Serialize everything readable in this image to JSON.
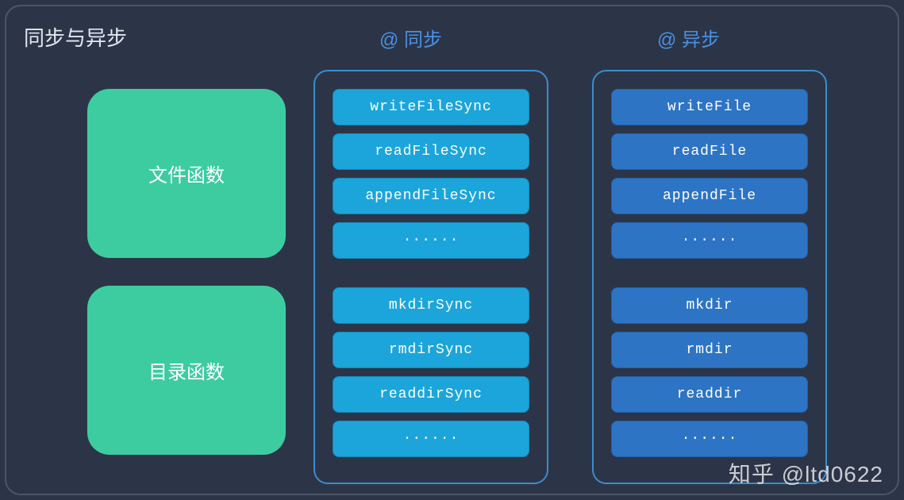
{
  "title": "同步与异步",
  "columns": {
    "sync": {
      "header": "@ 同步"
    },
    "async": {
      "header": "@ 异步"
    }
  },
  "categories": {
    "file": {
      "label": "文件函数"
    },
    "dir": {
      "label": "目录函数"
    }
  },
  "sync_file": [
    "writeFileSync",
    "readFileSync",
    "appendFileSync",
    "······"
  ],
  "sync_dir": [
    "mkdirSync",
    "rmdirSync",
    "readdirSync",
    "······"
  ],
  "async_file": [
    "writeFile",
    "readFile",
    "appendFile",
    "······"
  ],
  "async_dir": [
    "mkdir",
    "rmdir",
    "readdir",
    "······"
  ],
  "watermark": "知乎 @ltd0622"
}
